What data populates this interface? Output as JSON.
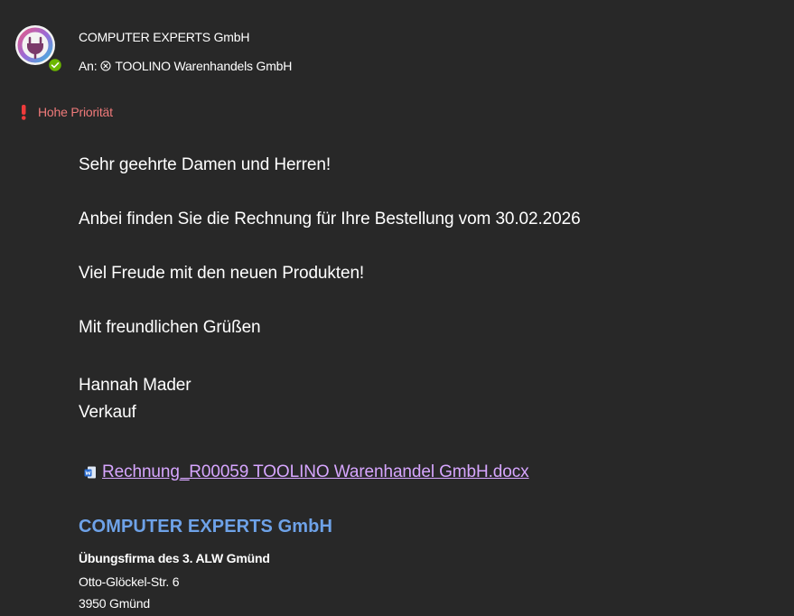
{
  "header": {
    "sender": "COMPUTER EXPERTS GmbH",
    "recipient_prefix": "An:",
    "recipient": "TOOLINO Warenhandels GmbH",
    "avatar_icon": "plug-icon",
    "status_icon": "check-circle-icon",
    "status_color": "#6bb700"
  },
  "priority": {
    "icon": "exclamation-icon",
    "label": "Hohe Priorität",
    "color": "#ef7a7a"
  },
  "body": {
    "greeting": "Sehr geehrte Damen und Herren!",
    "line1": "Anbei finden Sie die Rechnung für Ihre Bestellung vom 30.02.2026",
    "line2": "Viel Freude mit den neuen Produkten!",
    "closing": "Mit freundlichen Grüßen",
    "name": "Hannah Mader",
    "role": "Verkauf"
  },
  "attachment": {
    "icon": "word-document-icon",
    "filename": "Rechnung_R00059 TOOLINO Warenhandel GmbH.docx",
    "link_color": "#d7a6ff"
  },
  "signature": {
    "company": "COMPUTER EXPERTS GmbH",
    "company_color": "#6ea2e8",
    "subtitle": "Übungsfirma des 3. ALW Gmünd",
    "street": "Otto-Glöckel-Str. 6",
    "city": "3950 Gmünd"
  }
}
